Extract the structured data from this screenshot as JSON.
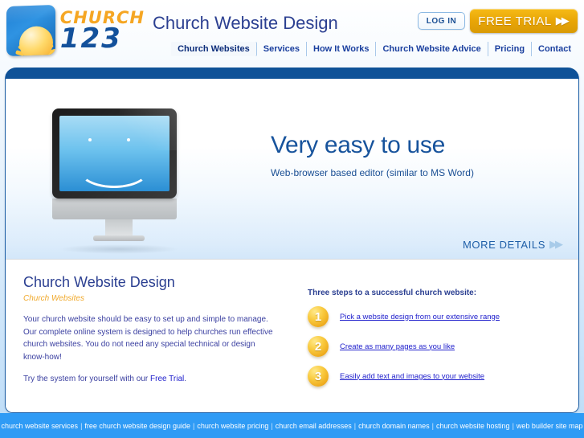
{
  "header": {
    "logo": {
      "icon": "sunrise-logo-icon",
      "word_top": "CHURCH",
      "word_bottom": "123"
    },
    "site_title": "Church Website Design",
    "login_label": "LOG IN",
    "trial_label": "FREE TRIAL",
    "trial_chevron": "▶▶"
  },
  "nav": {
    "items": [
      {
        "label": "Church Websites",
        "active": true
      },
      {
        "label": "Services",
        "active": false
      },
      {
        "label": "How It Works",
        "active": false
      },
      {
        "label": "Church Website Advice",
        "active": false
      },
      {
        "label": "Pricing",
        "active": false
      },
      {
        "label": "Contact",
        "active": false
      }
    ]
  },
  "hero": {
    "headline": "Very easy to use",
    "subline": "Web-browser based editor (similar to MS Word)",
    "more_details_label": "MORE DETAILS",
    "more_details_chevron": "▶▶",
    "monitor_icon": "desktop-monitor-smiley-icon"
  },
  "content": {
    "heading": "Church Website Design",
    "subheading": "Church Websites",
    "paragraph1": "Your church website should be easy to set up and simple to manage. Our complete online system is designed to help churches run effective church websites. You do not need any special technical or design know-how!",
    "paragraph2_before": "Try the system for yourself with our ",
    "paragraph2_link": "Free Trial",
    "paragraph2_after": ".",
    "steps_title": "Three steps to a successful church website:",
    "steps": [
      {
        "number": "1",
        "label": "Pick a website design from our extensive range"
      },
      {
        "number": "2",
        "label": "Create as many pages as you like"
      },
      {
        "number": "3",
        "label": "Easily add text and images to your website"
      }
    ]
  },
  "footer": {
    "links": [
      "church website services",
      "free church website design guide",
      "church website pricing",
      "church email addresses",
      "church domain names",
      "church website hosting",
      "web builder site map"
    ],
    "separator": "|"
  },
  "colors": {
    "brand_blue": "#13519b",
    "brand_orange": "#f5a623",
    "panel_border": "#0f5298",
    "footer_bg": "#2f9bf5",
    "link_blue": "#2020cc"
  }
}
